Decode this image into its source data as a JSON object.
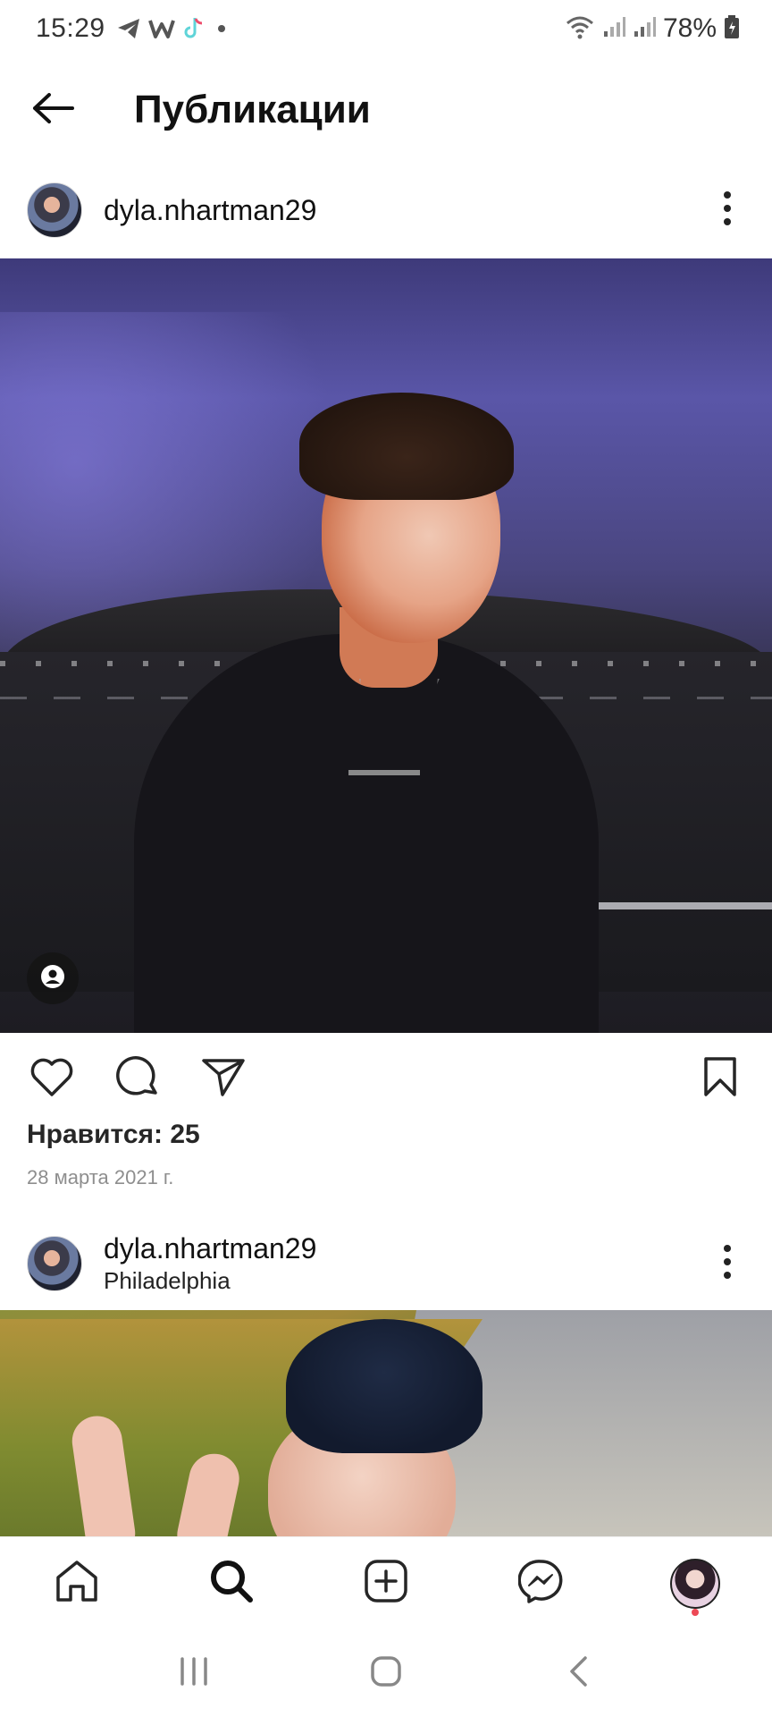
{
  "status_bar": {
    "time": "15:29",
    "battery": "78%",
    "icons": [
      "telegram-icon",
      "w-app-icon",
      "tiktok-icon",
      "notification-dot",
      "wifi-icon",
      "signal-icon",
      "signal-icon",
      "battery-icon"
    ]
  },
  "header": {
    "title": "Публикации",
    "back_icon": "arrow-left-icon"
  },
  "posts": [
    {
      "username": "dyla.nhartman29",
      "location": "",
      "likes_text": "Нравится: 25",
      "date": "28 марта 2021 г.",
      "actions": [
        "heart-icon",
        "comment-icon",
        "share-icon",
        "bookmark-icon"
      ]
    },
    {
      "username": "dyla.nhartman29",
      "location": "Philadelphia"
    }
  ],
  "bottom_nav": [
    "home-icon",
    "search-icon",
    "create-post-icon",
    "messenger-icon",
    "profile-avatar"
  ],
  "colors": {
    "text": "#262626",
    "secondary_text": "#8e8e8e",
    "notification_dot": "#ed4956"
  }
}
